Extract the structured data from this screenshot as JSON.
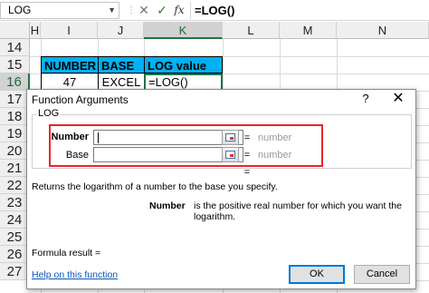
{
  "formula_bar": {
    "name_box": "LOG",
    "name_box_arrow": "▼",
    "grip": "⋮",
    "cancel_icon": "✕",
    "enter_icon": "✓",
    "fx_label": "fx",
    "formula": "=LOG()"
  },
  "sheet": {
    "columns": [
      "H",
      "I",
      "J",
      "K",
      "L",
      "M",
      "N"
    ],
    "selected_column": "K",
    "rows": [
      "14",
      "15",
      "16",
      "17",
      "18",
      "19",
      "20",
      "21",
      "22",
      "23",
      "24",
      "25",
      "26",
      "27"
    ],
    "selected_row": "16",
    "table_headers": [
      "NUMBER",
      "BASE",
      "LOG value"
    ],
    "table_row": [
      "47",
      "EXCEL",
      "=LOG()"
    ],
    "header_fill": "#00b0f0",
    "accent": "#217346"
  },
  "dialog": {
    "title": "Function Arguments",
    "help_icon": "?",
    "close_icon": "✕",
    "function_name": "LOG",
    "args": [
      {
        "label": "Number",
        "value": "",
        "result": "number"
      },
      {
        "label": "Base",
        "value": "",
        "result": "number"
      }
    ],
    "equals": "=",
    "overall_equals": "=",
    "description": "Returns the logarithm of a number to the base you specify.",
    "arg_desc_name": "Number",
    "arg_desc_text": "is the positive real number for which you want the logarithm.",
    "formula_result": "Formula result =",
    "help_link": "Help on this function",
    "ok_label": "OK",
    "cancel_label": "Cancel",
    "highlight_color": "#e8252b"
  }
}
